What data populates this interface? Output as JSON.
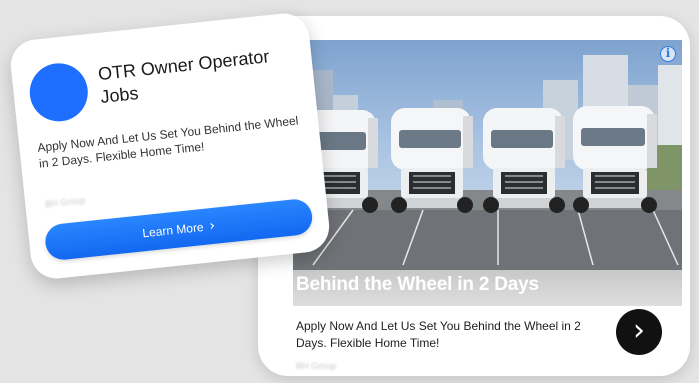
{
  "small_ad": {
    "title": "OTR Owner Operator Jobs",
    "body": "Apply Now And Let Us Set You Behind the Wheel in 2 Days. Flexible Home Time!",
    "advertiser": "BH Group",
    "cta_label": "Learn More",
    "cta_icon": "chevron-right-icon",
    "brand_color": "#1e6fff",
    "button_color": "#1a73ff"
  },
  "big_ad": {
    "headline": "Behind the Wheel in 2 Days",
    "body": "Apply Now And Let Us Set You Behind the Wheel in 2 Days. Flexible Home Time!",
    "advertiser": "BH Group",
    "info_icon": "info-icon",
    "info_glyph": "i",
    "next_icon": "chevron-right-icon",
    "next_glyph": "›",
    "image_description": "four-white-semi-trucks"
  }
}
